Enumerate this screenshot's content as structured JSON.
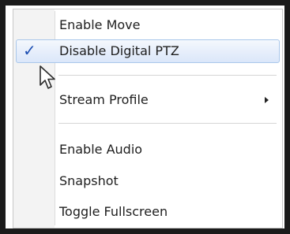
{
  "menu": {
    "items": [
      {
        "label": "Enable Move",
        "checked": false,
        "has_submenu": false,
        "selected": false
      },
      {
        "label": "Disable Digital PTZ",
        "checked": true,
        "has_submenu": false,
        "selected": true
      },
      {
        "label": "Stream Profile",
        "checked": false,
        "has_submenu": true,
        "selected": false
      },
      {
        "label": "Enable Audio",
        "checked": false,
        "has_submenu": false,
        "selected": false
      },
      {
        "label": "Snapshot",
        "checked": false,
        "has_submenu": false,
        "selected": false
      },
      {
        "label": "Toggle Fullscreen",
        "checked": false,
        "has_submenu": false,
        "selected": false
      }
    ],
    "check_mark": "✓",
    "icons": {
      "check": "checkmark-icon",
      "submenu": "submenu-arrow-icon",
      "cursor": "mouse-pointer-icon"
    },
    "colors": {
      "highlight_border": "#a9c7ea",
      "highlight_fill": "#dbe7fa",
      "check": "#1d4fb3",
      "gutter": "#f3f3f3"
    }
  }
}
